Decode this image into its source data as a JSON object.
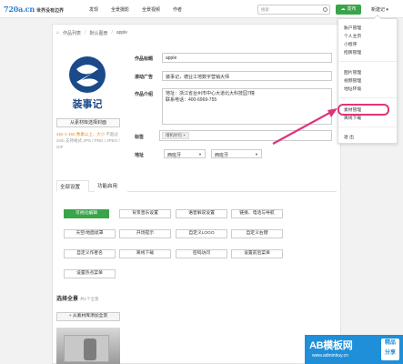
{
  "header": {
    "logo_main": "720a.cn",
    "logo_tag": "世界没有边界",
    "nav": [
      "发现",
      "全景摄影",
      "全景视频",
      "作者"
    ],
    "search_placeholder": "搜索",
    "publish_label": "发布",
    "user_label": "新建记"
  },
  "breadcrumb": {
    "items": [
      "作品列表",
      "默认图册",
      "apple"
    ]
  },
  "form": {
    "title_label": "作品标题",
    "title_value": "apple",
    "ad_label": "滚动广告",
    "ad_value": "装事记，德业工地数字营销大师",
    "intro_label": "作品介绍",
    "intro_line1": "地址：浙江省台州市中心大道北大科技园7幢",
    "intro_line2": "联系电话：400-6969-755",
    "tags_label": "标签",
    "tag_value": "增机抄包",
    "address_label": "地址",
    "country": "西班牙",
    "region": "西班牙"
  },
  "upload": {
    "button": "从素材库选择封面",
    "note_orange": "450 X 450 像素以上，大小",
    "note_muted": "不超过 2mb 支持格式 JPG / PNG / JPEG / GIF"
  },
  "tabs": [
    "全部设置",
    "功能启用"
  ],
  "settings_buttons": [
    "可视化编辑",
    "背景音乐设置",
    "语音解说设置",
    "链接、电话与导航",
    "天空/地面遮罩",
    "开场提示",
    "自定义LOGO",
    "自定义右键",
    "自定义作者名",
    "离线下载",
    "密码访问",
    "设置前后菜单",
    "设置热点菜单"
  ],
  "panorama": {
    "title": "选择全景",
    "count": "共1个全景",
    "add_button": "从素材库添加全景"
  },
  "menu": {
    "items_group1": [
      "账户管理",
      "个人主页",
      "小程序",
      "招牌管理"
    ],
    "items_group2": [
      "图片管理",
      "视频管理",
      "地址环境"
    ],
    "items_group3": [
      "素材管理",
      "离线下载"
    ],
    "logout": "退 出"
  },
  "watermark": {
    "main": "AB模板网",
    "url": "www.adminbuy.cn",
    "badge_top": "精品",
    "badge_bottom": "分享"
  },
  "colors": {
    "accent_green": "#3aa44a",
    "highlight": "#e0337a",
    "warning_orange": "#e2901a",
    "watermark_blue": "#1e8fd8"
  }
}
